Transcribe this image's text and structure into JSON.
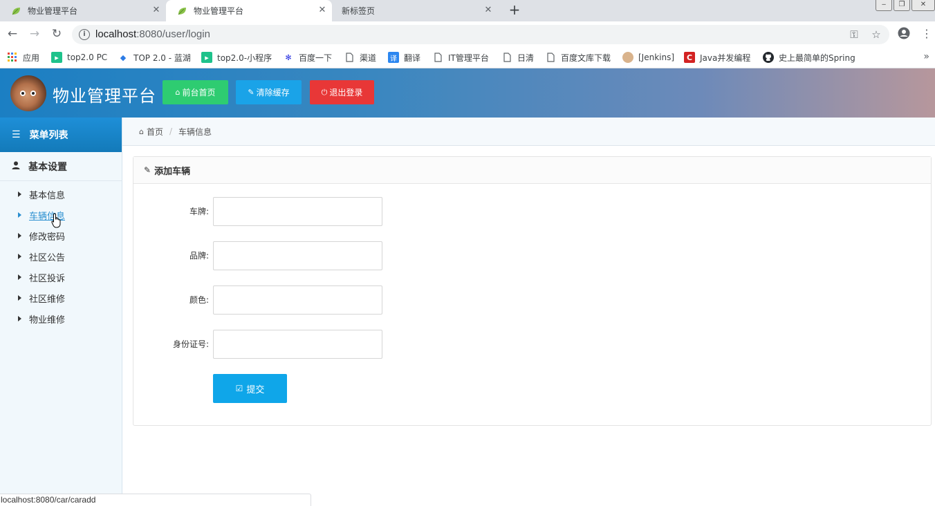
{
  "browser": {
    "tabs": [
      {
        "title": "物业管理平台"
      },
      {
        "title": "物业管理平台"
      },
      {
        "title": "新标签页"
      }
    ],
    "url": {
      "host": "localhost",
      "rest": ":8080/user/login"
    },
    "bookmarks": [
      {
        "label": "应用",
        "icon": "apps-grid-icon"
      },
      {
        "label": "top2.0 PC",
        "icon": "green-play-icon"
      },
      {
        "label": "TOP 2.0 - 蓝湖",
        "icon": "lanhu-icon"
      },
      {
        "label": "top2.0-小程序",
        "icon": "green-play-icon"
      },
      {
        "label": "百度一下",
        "icon": "baidu-paw-icon"
      },
      {
        "label": "渠道",
        "icon": "page-icon"
      },
      {
        "label": "翻译",
        "icon": "translate-icon"
      },
      {
        "label": "IT管理平台",
        "icon": "page-icon"
      },
      {
        "label": "日清",
        "icon": "page-icon"
      },
      {
        "label": "百度文库下载",
        "icon": "page-icon"
      },
      {
        "label": "[Jenkins]",
        "icon": "jenkins-icon"
      },
      {
        "label": "Java并发编程",
        "icon": "red-c-icon"
      },
      {
        "label": "史上最简单的Spring",
        "icon": "github-icon"
      }
    ],
    "bookmark_more": "»",
    "status_url": "localhost:8080/car/caradd"
  },
  "header": {
    "title": "物业管理平台",
    "buttons": {
      "home": "前台首页",
      "cache": "清除缓存",
      "logout": "退出登录"
    }
  },
  "sidebar": {
    "heading": "菜单列表",
    "group": "基本设置",
    "items": [
      {
        "label": "基本信息"
      },
      {
        "label": "车辆信息"
      },
      {
        "label": "修改密码"
      },
      {
        "label": "社区公告"
      },
      {
        "label": "社区投诉"
      },
      {
        "label": "社区维修"
      },
      {
        "label": "物业维修"
      }
    ]
  },
  "breadcrumb": {
    "home": "首页",
    "separator": "/",
    "current": "车辆信息"
  },
  "panel": {
    "title": "添加车辆",
    "fields": [
      {
        "label": "车牌:",
        "value": ""
      },
      {
        "label": "品牌:",
        "value": ""
      },
      {
        "label": "颜色:",
        "value": ""
      },
      {
        "label": "身份证号:",
        "value": ""
      }
    ],
    "submit": "提交"
  },
  "colors": {
    "header_start": "#1b7fc3",
    "btn_home": "#2ecc71",
    "btn_cache": "#1aa3e8",
    "btn_logout": "#e83737",
    "submit": "#0fa6e9",
    "active_link": "#2a8fd0"
  }
}
